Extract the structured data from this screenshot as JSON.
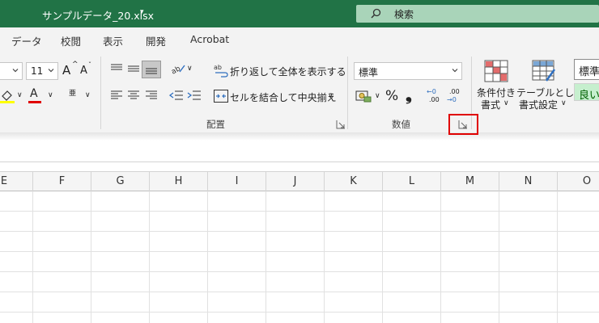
{
  "title": {
    "filename": "サンプルデータ_20.xlsx",
    "caret": "▾"
  },
  "search": {
    "placeholder": "検索"
  },
  "tabs": [
    "データ",
    "校閲",
    "表示",
    "開発",
    "Acrobat"
  ],
  "font": {
    "size": "11",
    "grow": "A",
    "shrink": "A",
    "furigana": "亜"
  },
  "alignment": {
    "wrap_text": "折り返して全体を表示する",
    "merge_center": "セルを結合して中央揃え",
    "group_label": "配置"
  },
  "number": {
    "format": "標準",
    "percent": "%",
    "comma": "❟",
    "increase_decimal_top": "←0",
    "increase_decimal_bottom": ".00",
    "decrease_decimal_top": ".00",
    "decrease_decimal_bottom": "→0",
    "group_label": "数値"
  },
  "styles": {
    "conditional_line1": "条件付き",
    "conditional_line2": "書式",
    "table_line1": "テーブルとして",
    "table_line2": "書式設定",
    "style_normal": "標準",
    "style_good": "良い"
  },
  "columns": [
    "E",
    "F",
    "G",
    "H",
    "I",
    "J",
    "K",
    "L",
    "M",
    "N",
    "O"
  ],
  "colors": {
    "excel_green": "#217346",
    "highlight": "#e00000",
    "good_bg": "#c6efce",
    "good_text": "#006100"
  }
}
